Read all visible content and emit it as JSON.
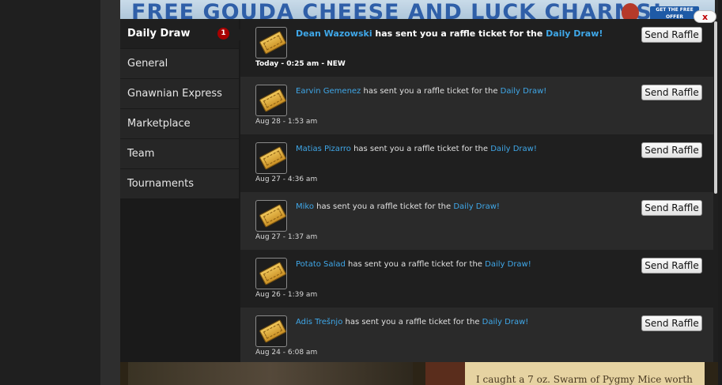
{
  "banner": {
    "text": "FREE GOUDA CHEESE AND LUCK CHARMS!",
    "cta": "GET THE FREE OFFER"
  },
  "background": {
    "snippet": "I caught a 7 oz. Swarm of Pygmy Mice worth"
  },
  "close": {
    "label": "x"
  },
  "sidebar": {
    "items": [
      {
        "label": "Daily Draw",
        "badge": "1",
        "active": true
      },
      {
        "label": "General"
      },
      {
        "label": "Gnawnian Express"
      },
      {
        "label": "Marketplace"
      },
      {
        "label": "Team"
      },
      {
        "label": "Tournaments"
      }
    ]
  },
  "notifications": [
    {
      "sender": "Dean Wazowski",
      "text": " has sent you a raffle ticket for the ",
      "link": "Daily Draw!",
      "time": "Today - 0:25 am - NEW",
      "button": "Send Raffle"
    },
    {
      "sender": "Earvin Gemenez",
      "text": " has sent you a raffle ticket for the ",
      "link": "Daily Draw!",
      "time": "Aug 28 - 1:53 am",
      "button": "Send Raffle"
    },
    {
      "sender": "Matias Pizarro",
      "text": " has sent you a raffle ticket for the ",
      "link": "Daily Draw!",
      "time": "Aug 27 - 4:36 am",
      "button": "Send Raffle"
    },
    {
      "sender": "Miko",
      "text": " has sent you a raffle ticket for the ",
      "link": "Daily Draw!",
      "time": "Aug 27 - 1:37 am",
      "button": "Send Raffle"
    },
    {
      "sender": "Potato Salad",
      "text": " has sent you a raffle ticket for the ",
      "link": "Daily Draw!",
      "time": "Aug 26 - 1:39 am",
      "button": "Send Raffle"
    },
    {
      "sender": "Adis Trešnjo",
      "text": " has sent you a raffle ticket for the ",
      "link": "Daily Draw!",
      "time": "Aug 24 - 6:08 am",
      "button": "Send Raffle"
    }
  ],
  "colors": {
    "link": "#3fa7e8",
    "badge": "#a80000",
    "panel": "#1a1a1a"
  }
}
